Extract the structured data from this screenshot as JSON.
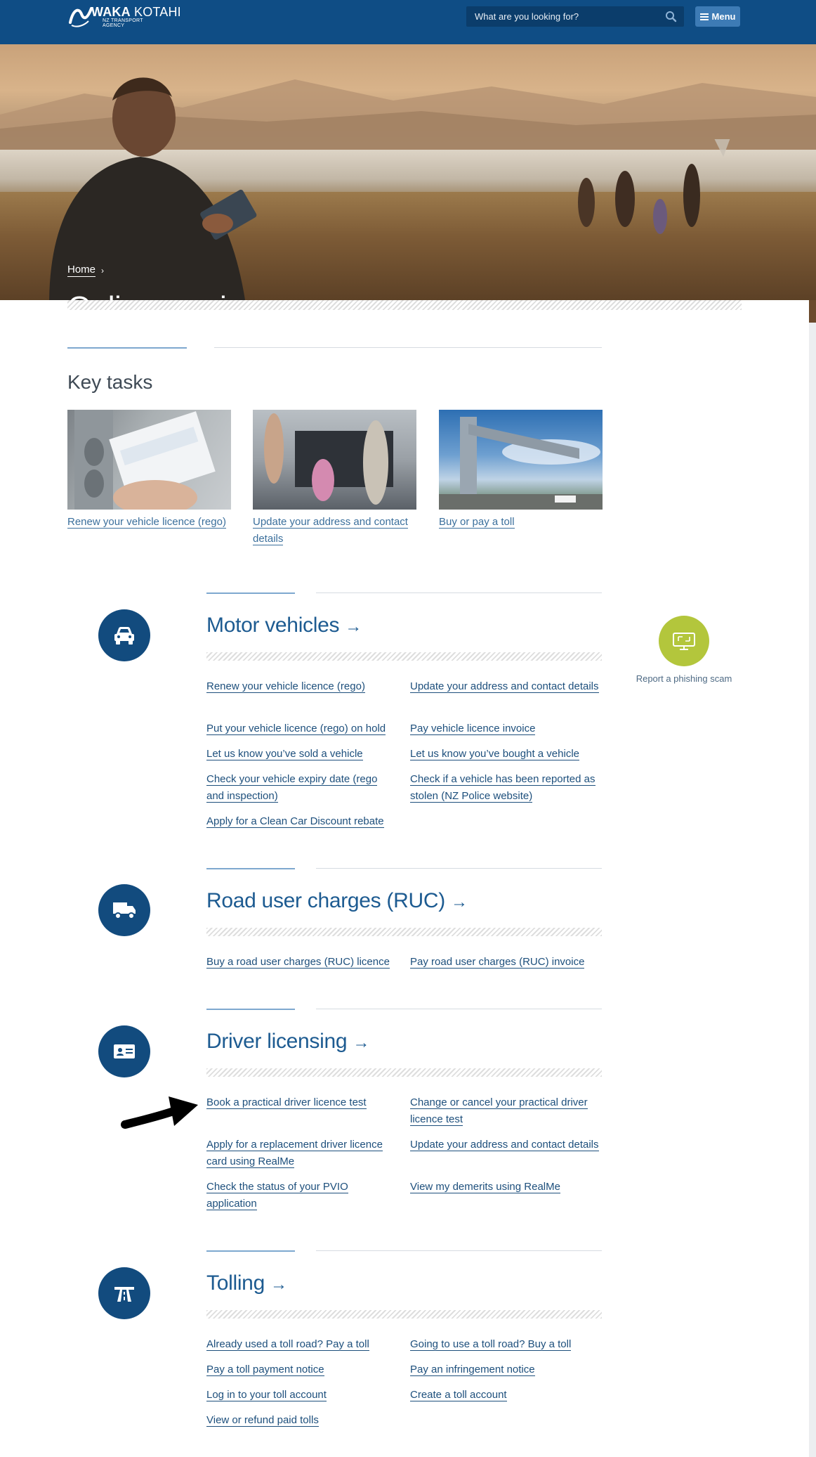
{
  "header": {
    "logo_primary": "WAKA",
    "logo_secondary": "KOTAHI",
    "logo_tagline": "NZ TRANSPORT AGENCY",
    "search_placeholder": "What are you looking for?",
    "menu_label": "Menu",
    "colors": {
      "bar": "#0f4d85",
      "menu_button": "#3d7bb5"
    }
  },
  "hero": {
    "breadcrumb_home": "Home",
    "breadcrumb_separator": "›",
    "title": "Online services"
  },
  "key_tasks": {
    "heading": "Key tasks",
    "items": [
      {
        "label": "Renew your vehicle licence (rego)"
      },
      {
        "label": "Update your address and contact details"
      },
      {
        "label": "Buy or pay a toll"
      }
    ]
  },
  "groups": [
    {
      "title": "Motor vehicles",
      "icon": "car-icon",
      "links": [
        "Renew your vehicle licence (rego)",
        "Update your address and contact details",
        "Put your vehicle licence (rego) on hold",
        "Pay vehicle licence invoice",
        "Let us know you’ve sold a vehicle",
        "Let us know you’ve bought a vehicle",
        "Check your vehicle expiry date (rego and inspection)",
        "Check if a vehicle has been reported as stolen (NZ Police website)",
        "Apply for a Clean Car Discount rebate"
      ]
    },
    {
      "title": "Road user charges (RUC)",
      "icon": "truck-icon",
      "links": [
        "Buy a road user charges (RUC) licence",
        "Pay road user charges (RUC) invoice"
      ]
    },
    {
      "title": "Driver licensing",
      "icon": "id-card-icon",
      "links": [
        "Book a practical driver licence test",
        "Change or cancel your practical driver licence test",
        "Apply for a replacement driver licence card using RealMe",
        "Update your address and contact details",
        "Check the status of your PVIO application",
        "View my demerits using RealMe"
      ]
    },
    {
      "title": "Tolling",
      "icon": "toll-road-icon",
      "links": [
        "Already used a toll road? Pay a toll",
        "Going to use a toll road? Buy a toll",
        "Pay a toll payment notice",
        "Pay an infringement notice",
        "Log in to your toll account",
        "Create a toll account",
        "View or refund paid tolls"
      ]
    }
  ],
  "arrows": {
    "group_title_arrow": "→"
  },
  "sidebar": {
    "phishing_label": "Report a phishing scam",
    "icon": "computer-warning-icon",
    "color": "#b3c63c"
  },
  "annotation": {
    "icon": "pointer-arrow-icon"
  }
}
